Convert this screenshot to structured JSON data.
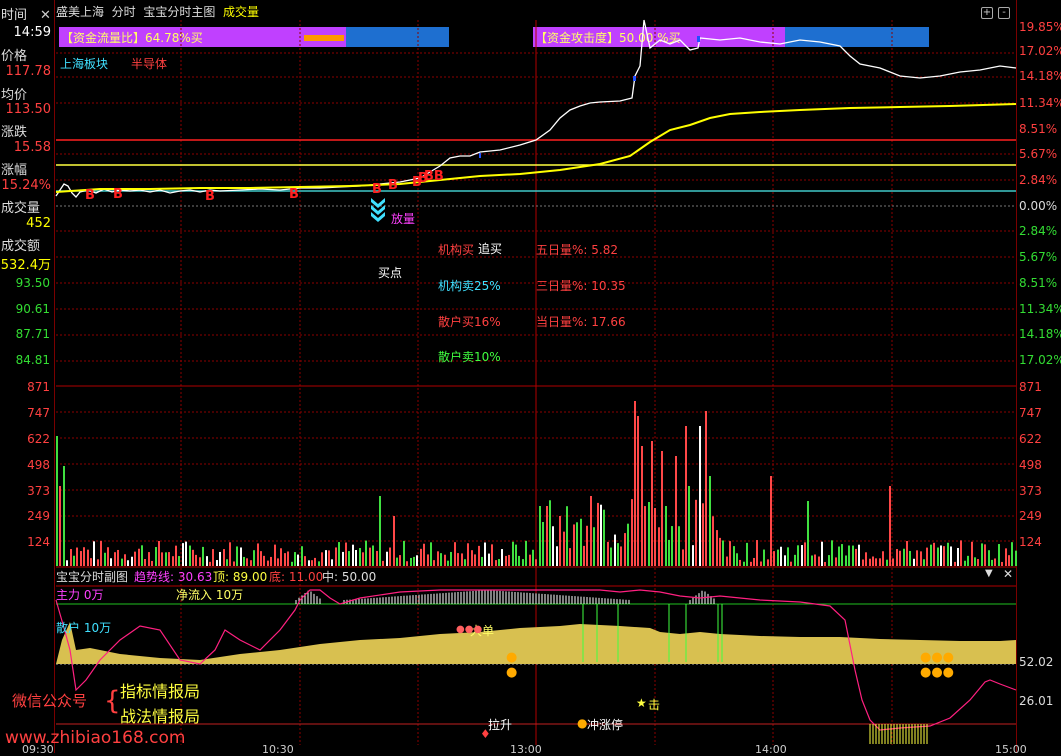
{
  "header": {
    "stock_name": "盛美上海",
    "mode": "分时",
    "main_title": "宝宝分时主图",
    "volume_label": "成交量"
  },
  "left_panel": {
    "time_label": "时间",
    "time_value": "14:59",
    "price_label": "价格",
    "price_value": "117.78",
    "avg_label": "均价",
    "avg_value": "113.50",
    "change_label": "涨跌",
    "change_value": "15.58",
    "pct_label": "涨幅",
    "pct_value": "15.24%",
    "vol_label": "成交量",
    "vol_value": "452",
    "amt_label": "成交额",
    "amt_value": "532.4万",
    "left_axis_sub": [
      "93.50",
      "90.61",
      "87.71",
      "84.81"
    ],
    "left_axis_vol": [
      "871",
      "747",
      "622",
      "498",
      "373",
      "249",
      "124"
    ]
  },
  "right_axis": {
    "pct_up": [
      "19.85%",
      "17.02%",
      "14.18%",
      "11.34%",
      "8.51%",
      "5.67%",
      "2.84%"
    ],
    "zero": "0.00%",
    "pct_down": [
      "2.84%",
      "5.67%",
      "8.51%",
      "11.34%",
      "14.18%",
      "17.02%"
    ],
    "vol": [
      "871",
      "747",
      "622",
      "498",
      "373",
      "249",
      "124"
    ],
    "sub": [
      "52.02",
      "26.01"
    ]
  },
  "indicators": {
    "flow_ratio": "【资金流量比】64.78%买",
    "attack_degree": "【资金攻击度】50.00 %买",
    "sector": "上海板块",
    "industry": "半导体",
    "release": "放量",
    "buy_point": "买点",
    "chase_buy": "追买",
    "inst_buy": "机构买",
    "inst_sell": "机构卖25%",
    "retail_buy": "散户买16%",
    "retail_sell": "散户卖10%",
    "five_day": "五日量%:  5.82",
    "three_day": "三日量%:  10.35",
    "today": "当日量%:  17.66"
  },
  "sub_chart": {
    "title": "宝宝分时副图",
    "trend": "趋势线: 30.63",
    "top": "顶: 89.00",
    "bottom": "底: 11.00",
    "mid": "中: 50.00",
    "main_force": "主力  0万",
    "net_inflow": "净流入  10万",
    "retail": "散户  10万",
    "big_order": "大单",
    "pull_up": "拉升",
    "limit_up": "冲涨停",
    "strike": "击"
  },
  "watermark": {
    "account_label": "微信公众号",
    "line1": "指标情报局",
    "line2": "战法情报局",
    "url": "www.zhibiao168.com"
  },
  "x_axis": [
    "09:30",
    "10:30",
    "13:00",
    "14:00",
    "15:00"
  ],
  "colors": {
    "up": "#ff3333",
    "down": "#33dd33",
    "price_line": "#ffffff",
    "avg_line": "#ffff00",
    "grid": "#8b0000",
    "purple": "#c040ff",
    "blue": "#1e6fd0"
  }
}
